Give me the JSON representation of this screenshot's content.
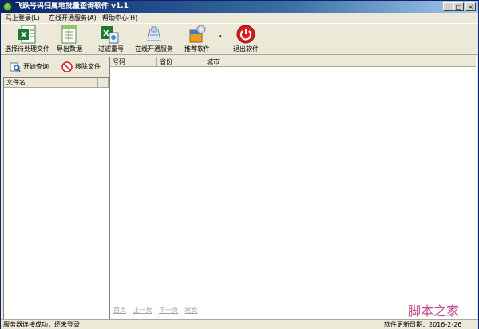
{
  "window": {
    "title": "飞跃号码归属地批量查询软件 v1.1",
    "controls": {
      "minimize": "_",
      "maximize": "□",
      "close": "×"
    }
  },
  "menubar": {
    "items": [
      {
        "label": "马上登录(L)"
      },
      {
        "label": "在线开通服务(A)"
      },
      {
        "label": "帮助中心(H)"
      }
    ]
  },
  "toolbar": {
    "buttons": [
      {
        "label": "选择待处理文件",
        "icon": "excel-file-icon"
      },
      {
        "label": "导出数据",
        "icon": "export-sheet-icon"
      },
      {
        "label": "过滤重号",
        "icon": "filter-duplicates-icon"
      },
      {
        "label": "在线开通服务",
        "icon": "online-service-icon"
      },
      {
        "label": "推荐软件",
        "icon": "software-box-icon"
      },
      {
        "label": "退出软件",
        "icon": "power-icon"
      }
    ],
    "dropdown_arrow": "▾"
  },
  "left_panel": {
    "start_query_label": "开始查询",
    "remove_file_label": "移除文件",
    "file_list_header": "文件名"
  },
  "results": {
    "columns": [
      "号码",
      "省份",
      "城市"
    ],
    "pager": [
      "首页",
      "上一页",
      "下一页",
      "尾页"
    ]
  },
  "statusbar": {
    "message": "服务器连接成功，还未登录",
    "update_date": "软件更新日期：2016-2-26"
  },
  "watermark": "脚本之家",
  "colors": {
    "titlebar": "#0a246a",
    "window_bg": "#ece9d8",
    "watermark": "#c24a8a",
    "power_red": "#d61f1f"
  }
}
